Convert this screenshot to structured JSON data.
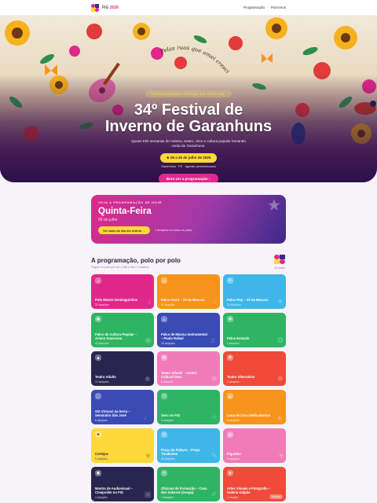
{
  "header": {
    "brand_prefix": "FIG",
    "brand_year": "2026",
    "nav": [
      "Programação",
      "Parceiros"
    ],
    "logo_colors": [
      "#e0288a",
      "#3a2a8a",
      "#ffd83a",
      "#e0288a"
    ]
  },
  "hero": {
    "eyebrow": "Programação oficial do festival",
    "title_line1": "34º Festival de",
    "title_line2": "Inverno de Garanhuns",
    "subtitle": "Quase três semanas de música, teatro, circo e cultura popular tomando conta de Garanhuns.",
    "date_pill": "09 a 26 de julho de 2026",
    "location": "Garanhuns · PE · Agreste pernambucano",
    "cta": "Bora ver a programação",
    "arc_text": "Pelas ruas que amei cresci"
  },
  "today": {
    "eyebrow": "Veja a programação de hoje",
    "day": "Quinta-Feira",
    "date": "09 de julho",
    "button": "Ver todo do dia em ordem",
    "count": "3 atrações em todos os polos"
  },
  "section": {
    "title": "A programação, polo por polo",
    "subtitle": "Toque no polo pra ver o dia a dia e horários",
    "count": "18 polos"
  },
  "cards": [
    {
      "name": "Polo Mestre Dominguinhos",
      "count": "33 atrações",
      "color": "#e0288a",
      "icon": "accordion-icon",
      "glyph": "♪",
      "dark": false
    },
    {
      "name": "Palco Forró – Zé da Macuca",
      "count": "30 atrações",
      "color": "#f7941d",
      "icon": "speaker-icon",
      "glyph": "♫",
      "dark": false
    },
    {
      "name": "Palco Pop – Zé da Macuca",
      "count": "24 atrações",
      "color": "#3fb6e8",
      "icon": "star-icon",
      "glyph": "✦",
      "dark": false
    },
    {
      "name": "Palco de Cultura Popular – Ariano Suassuna",
      "count": "43 atrações",
      "color": "#2fb463",
      "icon": "drum-icon",
      "glyph": "◉",
      "dark": false
    },
    {
      "name": "Palco de Música Instrumental – Paulo Rafael",
      "count": "16 atrações",
      "color": "#3a4bb5",
      "icon": "guitar-icon",
      "glyph": "♬",
      "dark": false
    },
    {
      "name": "Palco Estação",
      "count": "4 atrações",
      "color": "#2fb463",
      "icon": "train-icon",
      "glyph": "✿",
      "dark": false
    },
    {
      "name": "Teatro Adulto",
      "count": "12 atrações",
      "color": "#2a2550",
      "icon": "mask-icon",
      "glyph": "☻",
      "dark": false
    },
    {
      "name": "Teatro Infantil – Centro Cultural Sesc",
      "count": "8 atrações",
      "color": "#f07bb8",
      "icon": "balloon-icon",
      "glyph": "❀",
      "dark": false
    },
    {
      "name": "Teatro Alternativo",
      "count": "8 atrações",
      "color": "#ef4a3a",
      "icon": "spotlight-icon",
      "glyph": "✺",
      "dark": false
    },
    {
      "name": "XIX Virtuosi na Serra – Seminário São José",
      "count": "6 atrações",
      "color": "#3a4bb5",
      "icon": "violin-icon",
      "glyph": "♩",
      "dark": false
    },
    {
      "name": "Sesc no FIG",
      "count": "6 atrações",
      "color": "#2fb463",
      "icon": "sparkle-icon",
      "glyph": "✧",
      "dark": false
    },
    {
      "name": "Lona de Circo Bella Martins",
      "count": "9 atrações",
      "color": "#f7941d",
      "icon": "tent-icon",
      "glyph": "▲",
      "dark": false
    },
    {
      "name": "Cortejos",
      "count": "5 atrações",
      "color": "#ffd83a",
      "icon": "flag-icon",
      "glyph": "★",
      "dark": true
    },
    {
      "name": "Praça da Palavra – Praça Tiradentes",
      "count": "28 atrações",
      "color": "#3fb6e8",
      "icon": "book-icon",
      "glyph": "✎",
      "dark": false
    },
    {
      "name": "Figuinho",
      "count": "9 atrações",
      "color": "#f07bb8",
      "icon": "heart-icon",
      "glyph": "♥",
      "dark": false
    },
    {
      "name": "Mostra de Audiovisual – Cinejardim no FIG",
      "count": "4 atrações",
      "color": "#2a2550",
      "icon": "film-icon",
      "glyph": "▣",
      "dark": false
    },
    {
      "name": "Oficinas de Formação – Casa dos Saberes (Aesga)",
      "count": "7 atrações",
      "color": "#2fb463",
      "icon": "pencil-icon",
      "glyph": "✐",
      "dark": false
    },
    {
      "name": "Artes Visuais e Fotografia – Galeria Galpão",
      "count": "1 atração",
      "color": "#ef4a3a",
      "icon": "camera-icon",
      "glyph": "◈",
      "dark": false,
      "badge": "Amanhã"
    }
  ]
}
